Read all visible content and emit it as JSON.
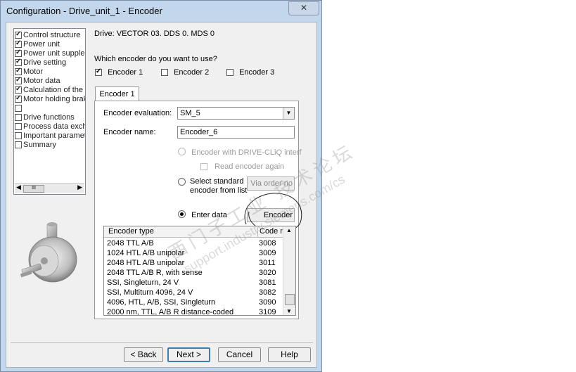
{
  "window": {
    "title": "Configuration - Drive_unit_1 - Encoder",
    "close_glyph": "✕"
  },
  "tree": {
    "items": [
      {
        "label": "Control structure",
        "checked": true
      },
      {
        "label": "Power unit",
        "checked": true
      },
      {
        "label": "Power unit supplementary data",
        "checked": true
      },
      {
        "label": "Drive setting",
        "checked": true
      },
      {
        "label": "Motor",
        "checked": true
      },
      {
        "label": "Motor data",
        "checked": true
      },
      {
        "label": "Calculation of the motor data",
        "checked": true
      },
      {
        "label": "Motor holding brake",
        "checked": true
      },
      {
        "label": "",
        "checked": false,
        "selected": true
      },
      {
        "label": "Drive functions",
        "checked": false
      },
      {
        "label": "Process data exchange",
        "checked": false
      },
      {
        "label": "Important parameters",
        "checked": false
      },
      {
        "label": "Summary",
        "checked": false
      }
    ],
    "scroll_left": "◀",
    "scroll_right": "▶",
    "scroll_thumb": "III"
  },
  "drive_info": "Drive: VECTOR  03. DDS 0. MDS 0",
  "question": "Which encoder do you want to use?",
  "encoders": [
    {
      "label": "Encoder 1",
      "checked": true
    },
    {
      "label": "Encoder 2",
      "checked": false
    },
    {
      "label": "Encoder 3",
      "checked": false
    }
  ],
  "tab": {
    "label": "Encoder 1"
  },
  "form": {
    "evaluation_label": "Encoder evaluation:",
    "evaluation_value": "SM_5",
    "name_label": "Encoder name:",
    "name_value": "Encoder_6",
    "opt_driveccliq": "Encoder with DRIVE-CLiQ interf",
    "read_again": "Read encoder again",
    "opt_standard_line1": "Select standard",
    "opt_standard_line2": "encoder from list",
    "via_order_btn": "Via order no",
    "opt_enter": "Enter data",
    "encoder_btn": "Encoder"
  },
  "list": {
    "col_type": "Encoder type",
    "col_code": "Code n",
    "rows": [
      {
        "type": "2048 TTL A/B",
        "code": "3008"
      },
      {
        "type": "1024 HTL A/B unipolar",
        "code": "3009"
      },
      {
        "type": "2048 HTL A/B unipolar",
        "code": "3011"
      },
      {
        "type": "2048 TTL A/B R, with sense",
        "code": "3020"
      },
      {
        "type": "SSI, Singleturn, 24 V",
        "code": "3081"
      },
      {
        "type": "SSI, Multiturn 4096, 24 V",
        "code": "3082"
      },
      {
        "type": "4096, HTL, A/B, SSI, Singleturn",
        "code": "3090"
      },
      {
        "type": "2000 nm, TTL, A/B R distance-coded",
        "code": "3109"
      }
    ],
    "scroll_up": "▲",
    "scroll_down": "▼"
  },
  "buttons": {
    "back": "< Back",
    "next": "Next >",
    "cancel": "Cancel",
    "help": "Help"
  },
  "watermark": {
    "cn": "西门子工业 技术论坛",
    "url": "support.industry.siemens.com/cs"
  },
  "colors": {
    "title_bar": "#c3d7ec",
    "selection": "#3399ff",
    "default_button_border": "#3c7fb1"
  }
}
